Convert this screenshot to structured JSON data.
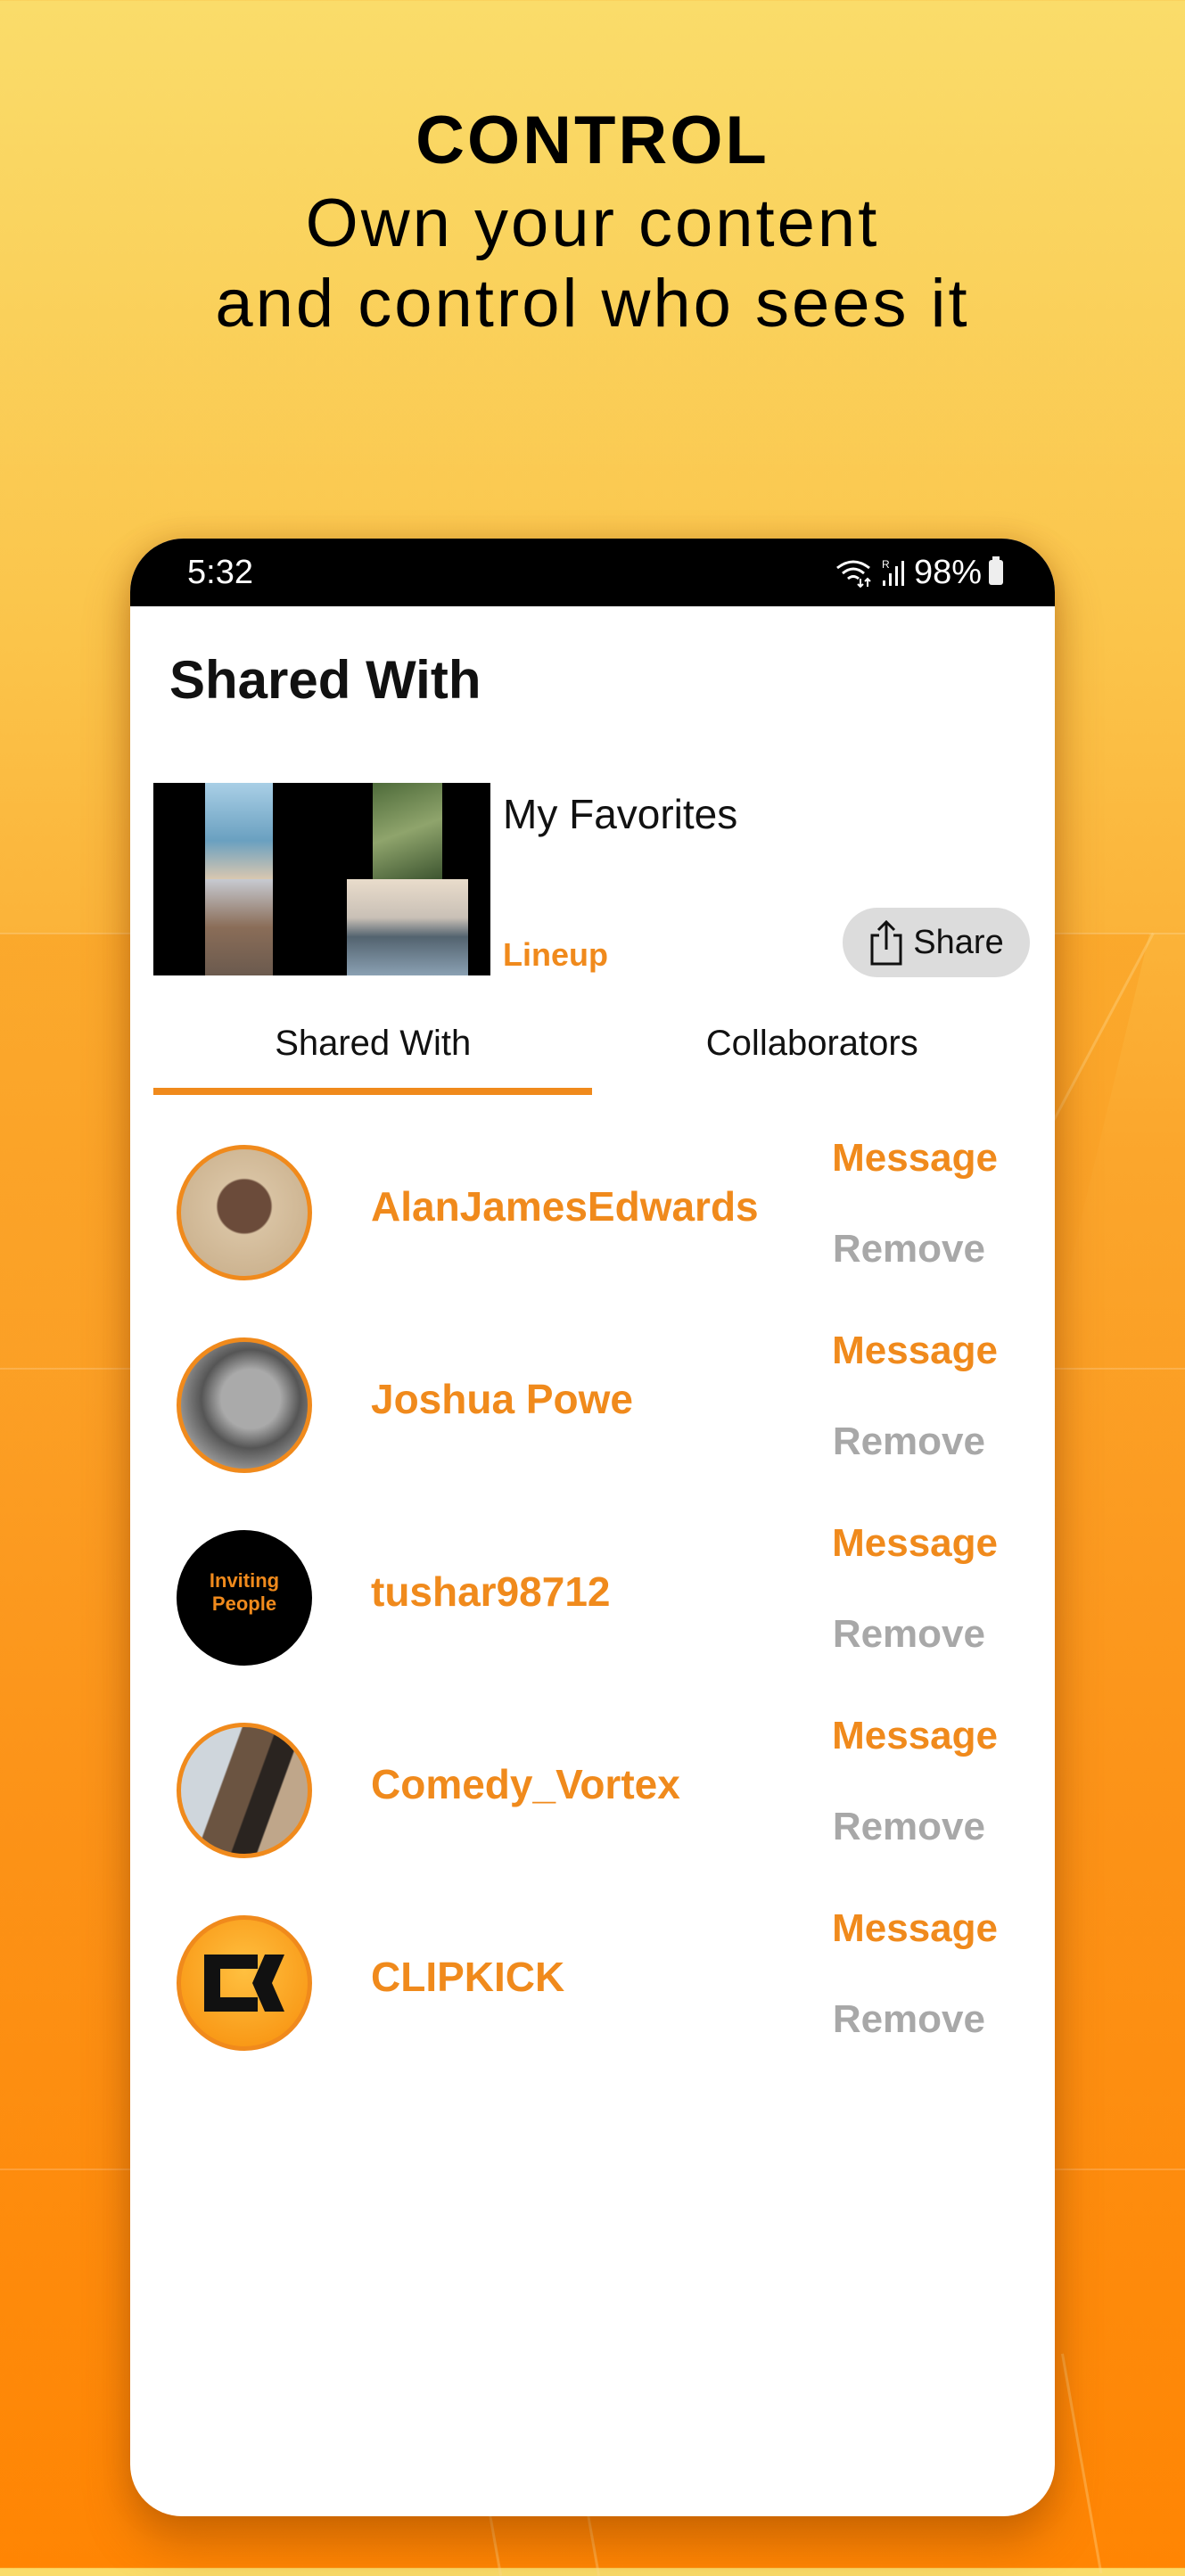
{
  "promo": {
    "heading": "CONTROL",
    "line1": "Own your content",
    "line2": "and control who sees it"
  },
  "status_bar": {
    "time": "5:32",
    "battery": "98%",
    "icons": [
      "wifi-icon",
      "signal-roaming-icon",
      "battery-icon"
    ]
  },
  "page": {
    "title": "Shared With"
  },
  "collection": {
    "title": "My Favorites",
    "type_label": "Lineup",
    "share_label": "Share"
  },
  "tabs": [
    {
      "label": "Shared With",
      "active": true
    },
    {
      "label": "Collaborators",
      "active": false
    }
  ],
  "users": [
    {
      "name": "AlanJamesEdwards",
      "message_label": "Message",
      "remove_label": "Remove"
    },
    {
      "name": "Joshua Powe",
      "message_label": "Message",
      "remove_label": "Remove"
    },
    {
      "name": "tushar98712",
      "avatar_text": "Inviting People",
      "message_label": "Message",
      "remove_label": "Remove"
    },
    {
      "name": "Comedy_Vortex",
      "message_label": "Message",
      "remove_label": "Remove"
    },
    {
      "name": "CLIPKICK",
      "message_label": "Message",
      "remove_label": "Remove"
    }
  ],
  "colors": {
    "accent": "#f08a1c",
    "muted": "#a8a8a8",
    "background_top": "#fadc6a",
    "background_bottom": "#ff8503"
  }
}
